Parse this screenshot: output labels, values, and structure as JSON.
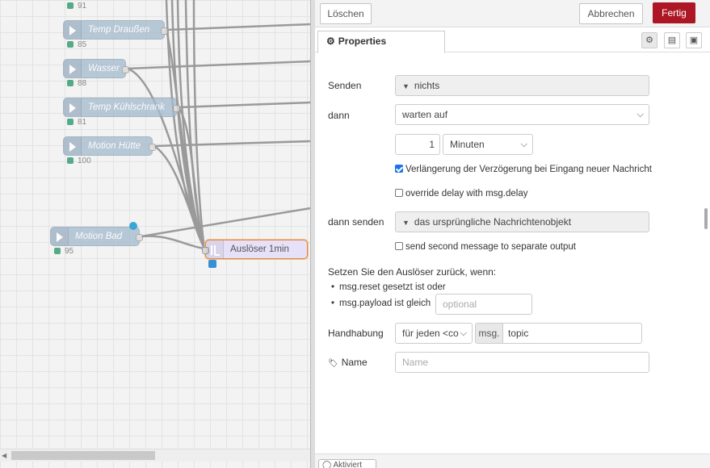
{
  "workspace": {
    "nodes": [
      {
        "label": "Temp Draußen",
        "status": "85"
      },
      {
        "label": "Wasser",
        "status": "88"
      },
      {
        "label": "Temp Kühlschrank",
        "status": "81"
      },
      {
        "label": "Motion Hütte",
        "status": "100"
      },
      {
        "label": "Motion Bad",
        "status": "95"
      }
    ],
    "top_status": "91",
    "trigger_node": {
      "label": "Auslöser 1min"
    }
  },
  "tray": {
    "delete_label": "Löschen",
    "cancel_label": "Abbrechen",
    "done_label": "Fertig",
    "tab_properties": "Properties",
    "footer_label": "Aktiviert"
  },
  "form": {
    "send_label": "Senden",
    "send_value": "nichts",
    "then_label": "dann",
    "then_value": "warten auf",
    "duration_value": "1",
    "duration_unit": "Minuten",
    "extend_label": "Verlängerung der Verzögerung bei Eingang neuer Nachricht",
    "extend_checked": true,
    "override_label": "override delay with msg.delay",
    "override_checked": false,
    "then_send_label": "dann senden",
    "then_send_value": "das ursprüngliche Nachrichtenobjekt",
    "second_output_label": "send second message to separate output",
    "second_output_checked": false,
    "reset_heading": "Setzen Sie den Auslöser zurück, wenn:",
    "reset_bullet_1": "msg.reset gesetzt ist oder",
    "reset_bullet_2": "msg.payload ist gleich",
    "reset_payload_placeholder": "optional",
    "handling_label": "Handhabung",
    "handling_value": "für jeden <co",
    "handling_prefix": "msg.",
    "handling_property": "topic",
    "name_label": "Name",
    "name_placeholder": "Name"
  },
  "colors": {
    "primary": "#ad1625",
    "node": "#a6bbcf",
    "trigger_border": "#e08b42",
    "status_dot": "#55aa88"
  }
}
